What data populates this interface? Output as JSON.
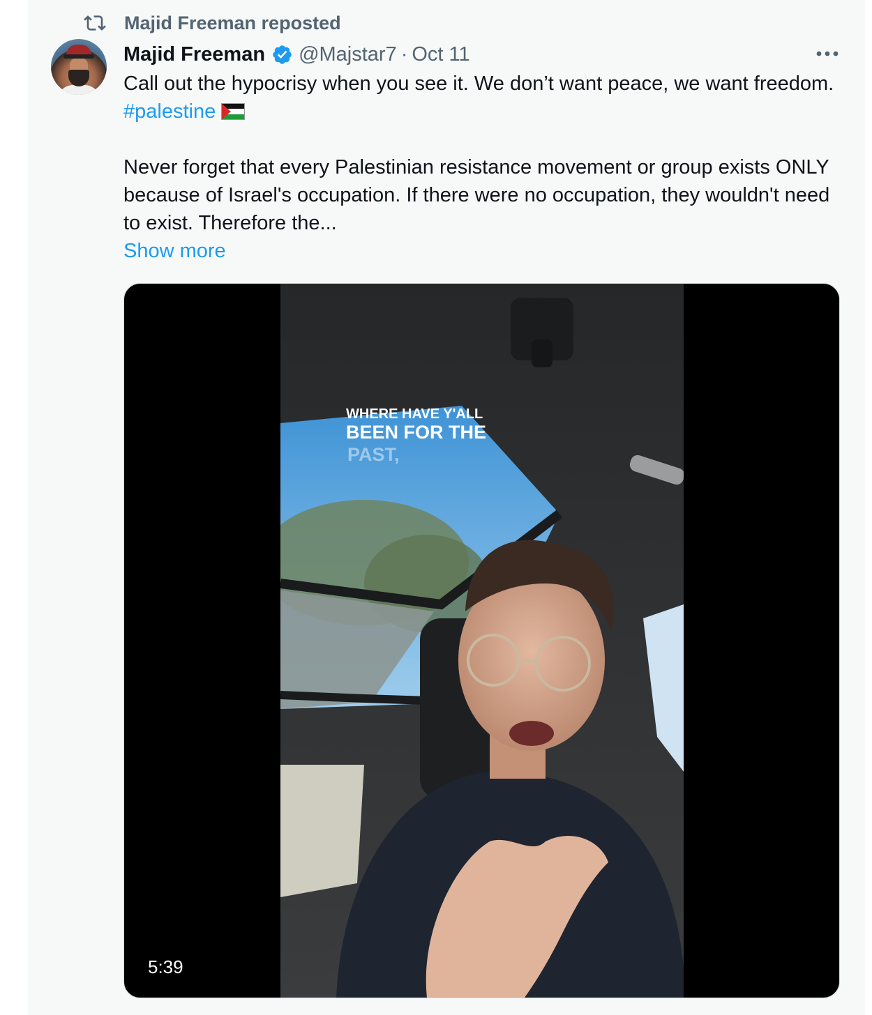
{
  "repost": {
    "label": "Majid Freeman reposted",
    "icon": "repost-icon"
  },
  "author": {
    "name": "Majid Freeman",
    "handle": "@Majstar7",
    "separator": "·",
    "date": "Oct 11",
    "verified_icon": "verified-badge-icon",
    "verified_color": "#1d9bf0"
  },
  "tweet": {
    "line1": "Call out the hypocrisy when you see it. We don’t want peace, we want freedom. ",
    "hashtag": "#palestine",
    "flag_icon": "palestine-flag-icon",
    "paragraph2": "Never forget that every Palestinian resistance movement or group exists ONLY because of Israel's occupation. If there were no occupation, they wouldn't need to exist. Therefore the...",
    "show_more": "Show more"
  },
  "media": {
    "caption_line1": "WHERE HAVE Y'ALL",
    "caption_line2": "BEEN FOR THE",
    "caption_line3": "PAST,",
    "duration": "5:39"
  },
  "colors": {
    "text": "#0f1419",
    "secondary": "#536471",
    "accent": "#1d9bf0",
    "background": "#f7f9f9"
  }
}
